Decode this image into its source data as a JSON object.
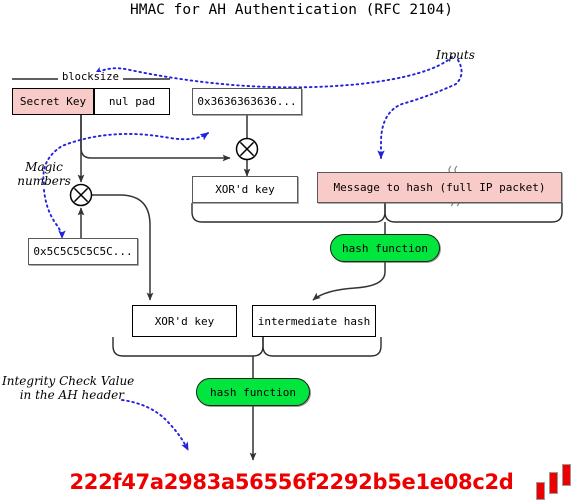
{
  "title": "HMAC for AH Authentication (RFC 2104)",
  "colors": {
    "key_fill": "#f9cbc8",
    "message_fill": "#f9cbc8",
    "hash_fill": "#00e63c",
    "digest_text": "#ee0000",
    "annotation_arrow": "#2222dd",
    "box_border": "#595959",
    "wire": "#333333"
  },
  "labels": {
    "blocksize": "blocksize"
  },
  "nodes": {
    "secret_key": "Secret Key",
    "nul_pad": "nul pad",
    "ipad": "0x3636363636...",
    "opad": "0x5C5C5C5C5C...",
    "xord_key_inner": "XOR'd key",
    "xord_key_outer": "XOR'd key",
    "message": "Message to hash (full IP packet)",
    "intermediate_hash": "intermediate hash",
    "hash_function_1": "hash function",
    "hash_function_2": "hash function"
  },
  "annotations": {
    "inputs": "Inputs",
    "magic_numbers_line1": "Magic",
    "magic_numbers_line2": "numbers",
    "icv_line1": "Integrity Check Value",
    "icv_line2": "in the AH header"
  },
  "operators": {
    "xor_inner": "xor-operator",
    "xor_outer": "xor-operator"
  },
  "digest": "222f47a2983a56556f2292b5e1e08c2d",
  "logo": {
    "name": "three-red-bars-logo",
    "bars": 3
  }
}
